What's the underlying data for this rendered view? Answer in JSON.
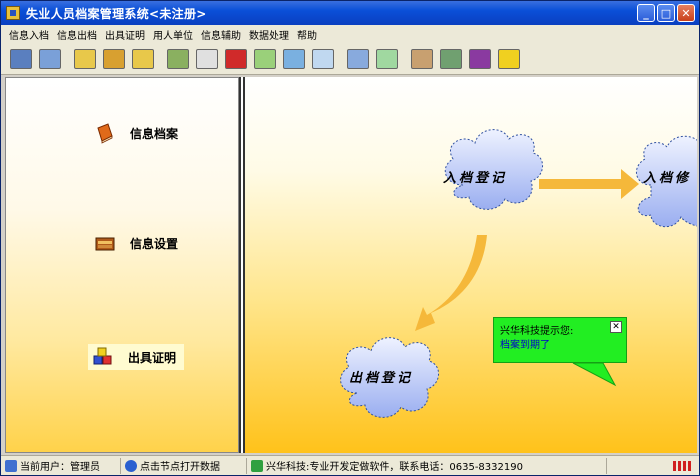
{
  "window": {
    "title": "失业人员档案管理系统<未注册>"
  },
  "menu": [
    "信息入档",
    "信息出档",
    "出具证明",
    "用人单位",
    "信息辅助",
    "数据处理",
    "帮助"
  ],
  "toolbar_icons": [
    {
      "name": "monitor-icon",
      "color": "#5a7fbf"
    },
    {
      "name": "screen-icon",
      "color": "#7aa0d8"
    },
    {
      "name": "folder-open-icon",
      "color": "#e8c84a"
    },
    {
      "name": "folders-icon",
      "color": "#d8a030"
    },
    {
      "name": "folder-icon",
      "color": "#e8c84a"
    },
    {
      "name": "scroll-icon",
      "color": "#8ab060"
    },
    {
      "name": "transfer-icon",
      "color": "#e0e0e0"
    },
    {
      "name": "umbrella-icon",
      "color": "#d02a2a"
    },
    {
      "name": "notebook-icon",
      "color": "#9ad07a"
    },
    {
      "name": "search-doc-icon",
      "color": "#7ab0e0"
    },
    {
      "name": "magnifier-icon",
      "color": "#c0d8f0"
    },
    {
      "name": "bell-icon",
      "color": "#88aadd"
    },
    {
      "name": "money-icon",
      "color": "#a0d8a0"
    },
    {
      "name": "picture-icon",
      "color": "#c8a070"
    },
    {
      "name": "pda-icon",
      "color": "#70a070"
    },
    {
      "name": "help-book-icon",
      "color": "#8a3aa0"
    },
    {
      "name": "exit-runner-icon",
      "color": "#f0d020"
    }
  ],
  "left_nav": [
    {
      "label": "信息档案",
      "icon": "book-icon"
    },
    {
      "label": "信息设置",
      "icon": "cabinet-icon"
    },
    {
      "label": "出具证明",
      "icon": "blocks-icon"
    }
  ],
  "flow": {
    "node_in": "入档登记",
    "node_modify": "入档修",
    "node_out": "出档登记"
  },
  "tip": {
    "title": "兴华科技提示您:",
    "body": "档案到期了",
    "close": "✕"
  },
  "status": {
    "user": "当前用户：管理员",
    "hint": "点击节点打开数据",
    "company": "兴华科技:专业开发定做软件，联系电话：0635-8332190"
  },
  "colors": {
    "accent": "#0a3fc0",
    "tip_bg": "#22ee22",
    "arrow": "#f5b83a"
  }
}
